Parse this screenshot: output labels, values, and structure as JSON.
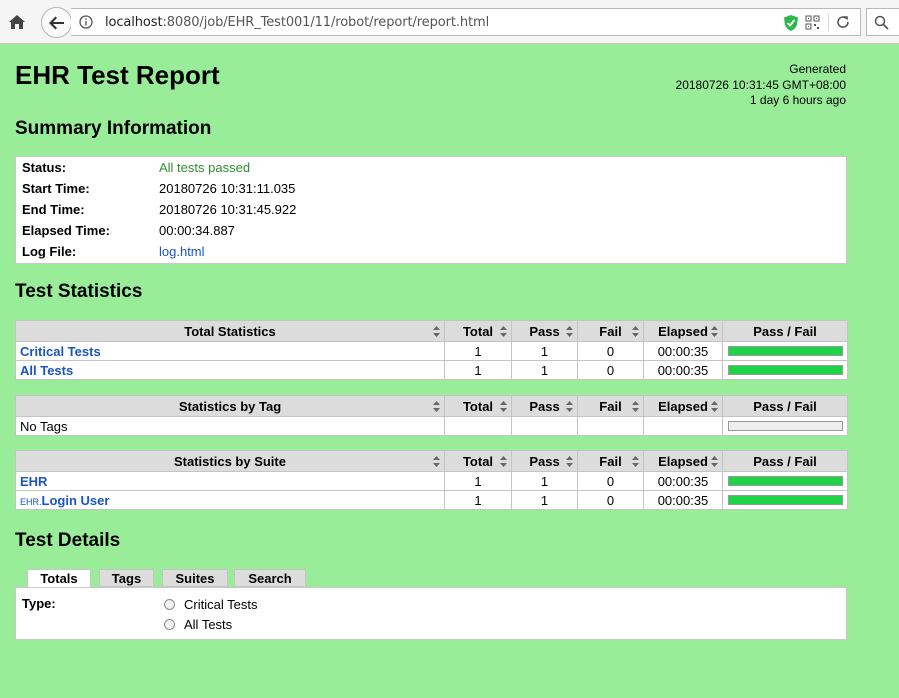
{
  "browser": {
    "url_host": "localhost",
    "url_rest": ":8080/job/EHR_Test001/11/robot/report/report.html"
  },
  "header": {
    "title": "EHR Test Report",
    "generated_label": "Generated",
    "generated_time": "20180726 10:31:45 GMT+08:00",
    "generated_ago": "1 day 6 hours ago"
  },
  "summary": {
    "heading": "Summary Information",
    "rows": [
      {
        "label": "Status:",
        "value": "All tests passed"
      },
      {
        "label": "Start Time:",
        "value": "20180726 10:31:11.035"
      },
      {
        "label": "End Time:",
        "value": "20180726 10:31:45.922"
      },
      {
        "label": "Elapsed Time:",
        "value": "00:00:34.887"
      },
      {
        "label": "Log File:",
        "value": "log.html"
      }
    ]
  },
  "statistics": {
    "heading": "Test Statistics",
    "columns": [
      "Total",
      "Pass",
      "Fail",
      "Elapsed",
      "Pass / Fail"
    ],
    "total_table": {
      "title": "Total Statistics",
      "rows": [
        {
          "name": "Critical Tests",
          "total": "1",
          "pass": "1",
          "fail": "0",
          "elapsed": "00:00:35",
          "pass_ratio": 1.0
        },
        {
          "name": "All Tests",
          "total": "1",
          "pass": "1",
          "fail": "0",
          "elapsed": "00:00:35",
          "pass_ratio": 1.0
        }
      ]
    },
    "tag_table": {
      "title": "Statistics by Tag",
      "empty_label": "No Tags"
    },
    "suite_table": {
      "title": "Statistics by Suite",
      "rows": [
        {
          "parent": "",
          "name": "EHR",
          "total": "1",
          "pass": "1",
          "fail": "0",
          "elapsed": "00:00:35",
          "pass_ratio": 1.0
        },
        {
          "parent": "EHR.",
          "name": "Login User",
          "total": "1",
          "pass": "1",
          "fail": "0",
          "elapsed": "00:00:35",
          "pass_ratio": 1.0
        }
      ]
    }
  },
  "details": {
    "heading": "Test Details",
    "tabs": [
      "Totals",
      "Tags",
      "Suites",
      "Search"
    ],
    "active_tab": "Totals",
    "type_label": "Type:",
    "options": [
      "Critical Tests",
      "All Tests"
    ]
  },
  "colors": {
    "background": "#99ed99",
    "pass": "#1ed446",
    "link": "#1a55c0"
  }
}
